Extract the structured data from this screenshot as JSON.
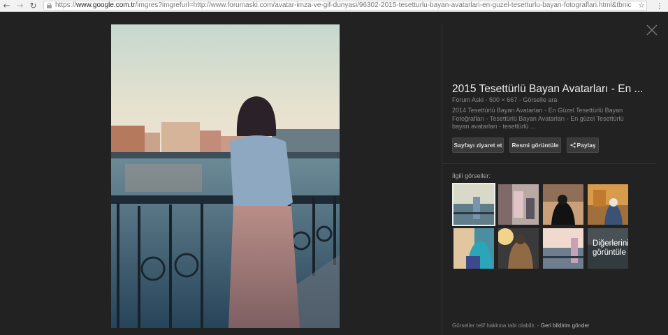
{
  "browser": {
    "url_scheme": "https://",
    "url_host": "www.google.com.tr",
    "url_rest": "/imgres?imgrefurl=http://www.forumaski.com/avatar-imza-ve-gif-dunyasi/96302-2015-tesetturlu-bayan-avatarlari-en-guzel-tesetturlu-bayan-fotograflari.html&tbnic",
    "back_icon": "arrow-left",
    "forward_icon": "arrow-right",
    "reload_icon": "reload",
    "star_icon": "star-outline",
    "menu_icon": "vertical-dots"
  },
  "panel": {
    "title": "2015 Tesettürlü Bayan Avatarları - En ...",
    "source": "Forum Aski",
    "dimensions": "500 × 667",
    "search_by_image": "Görselle ara",
    "description": "2014 Tesettürlü Bayan Avatarları - En Güzel Tesettürlü Bayan Fotoğrafları - Tesettürlü Bayan Avatarları - En güzel Tesettürlü bayan avatarları - tesettürlü ...",
    "buttons": {
      "visit": "Sayfayı ziyaret et",
      "view": "Resmi görüntüle",
      "share": "Paylaş"
    },
    "related_label": "İlgili görseller:",
    "more_label_line1": "Diğerlerini",
    "more_label_line2": "görüntüle",
    "footer_text": "Görseller telif hakkına tabi olabilir.",
    "footer_separator": "-",
    "footer_link": "Geri bildirim gönder"
  },
  "colors": {
    "background": "#222222",
    "text_primary": "#eeeeee",
    "text_muted": "#888888",
    "button_bg": "#3a3a3a"
  }
}
